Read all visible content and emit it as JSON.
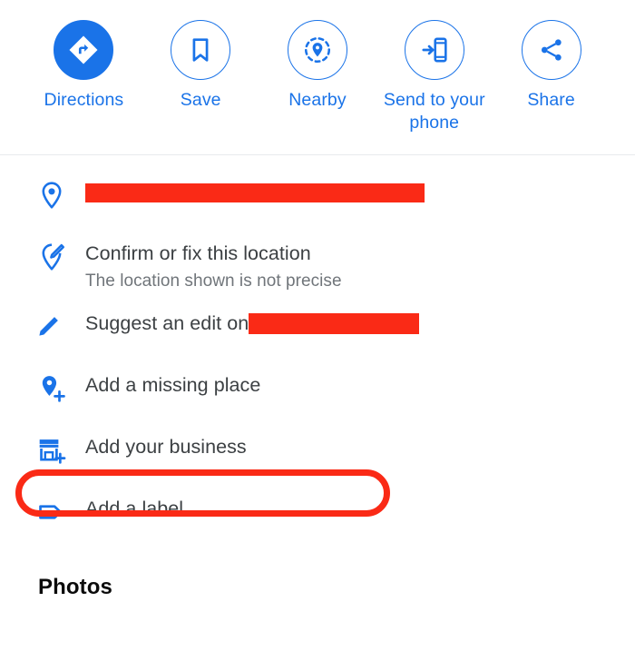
{
  "action_bar": {
    "buttons": [
      {
        "label": "Directions",
        "icon": "directions-icon",
        "style": "filled"
      },
      {
        "label": "Save",
        "icon": "bookmark-icon",
        "style": "outlined"
      },
      {
        "label": "Nearby",
        "icon": "nearby-search-icon",
        "style": "outlined"
      },
      {
        "label": "Send to your phone",
        "icon": "send-to-phone-icon",
        "style": "outlined"
      },
      {
        "label": "Share",
        "icon": "share-icon",
        "style": "outlined"
      }
    ]
  },
  "info_list": {
    "rows": [
      {
        "icon": "location-pin-icon",
        "primary": "",
        "secondary": "",
        "redacted": true
      },
      {
        "icon": "edit-location-icon",
        "primary": "Confirm or fix this location",
        "secondary": "The location shown is not precise"
      },
      {
        "icon": "pencil-icon",
        "primary": "Suggest an edit on",
        "secondary": "",
        "redacted_suffix": true
      },
      {
        "icon": "add-place-pin-icon",
        "primary": "Add a missing place",
        "secondary": ""
      },
      {
        "icon": "add-business-storefront-icon",
        "primary": "Add your business",
        "secondary": "",
        "highlighted": true
      },
      {
        "icon": "label-tag-icon",
        "primary": "Add a label",
        "secondary": ""
      }
    ]
  },
  "photos": {
    "heading": "Photos"
  },
  "colors": {
    "accent_blue": "#1a73e8",
    "annotation_red": "#fa2a16",
    "primary_text": "#3c4043",
    "secondary_text": "#70757a",
    "heading_text": "#0b0b0b",
    "divider": "#e8eaed",
    "background": "#ffffff"
  }
}
